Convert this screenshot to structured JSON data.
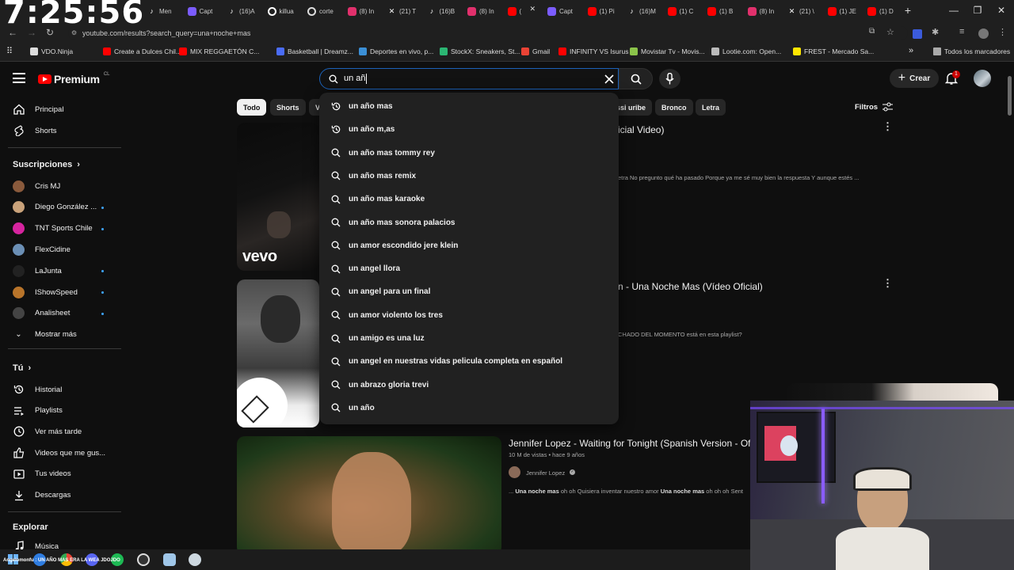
{
  "clock": "7:25:56",
  "tabs": [
    {
      "label": "Men",
      "color": "#ffffff",
      "kind": "tiktok"
    },
    {
      "label": "Capt",
      "color": "#7b5cff",
      "kind": "pen"
    },
    {
      "label": "(16)A",
      "color": "#ffffff",
      "kind": "tiktok"
    },
    {
      "label": "killua",
      "color": "#ffffff",
      "kind": "circle"
    },
    {
      "label": "corte",
      "color": "#dddddd",
      "kind": "google"
    },
    {
      "label": "(8) In",
      "color": "#e1306c",
      "kind": "insta"
    },
    {
      "label": "(21) T",
      "color": "#ffffff",
      "kind": "x"
    },
    {
      "label": "(16)B",
      "color": "#ffffff",
      "kind": "tiktok"
    },
    {
      "label": "(8) In",
      "color": "#e1306c",
      "kind": "insta"
    },
    {
      "label": "(",
      "color": "#ff0000",
      "kind": "yt"
    },
    {
      "label": "Capt",
      "color": "#7b5cff",
      "kind": "pen"
    },
    {
      "label": "(1) Pi",
      "color": "#ff0000",
      "kind": "yt"
    },
    {
      "label": "(16)M",
      "color": "#ffffff",
      "kind": "tiktok"
    },
    {
      "label": "(1) C",
      "color": "#ff0000",
      "kind": "yt"
    },
    {
      "label": "(1) B",
      "color": "#ff0000",
      "kind": "yt"
    },
    {
      "label": "(8) In",
      "color": "#e1306c",
      "kind": "insta"
    },
    {
      "label": "(21) \\",
      "color": "#ffffff",
      "kind": "x"
    },
    {
      "label": "(1) JE",
      "color": "#ff0000",
      "kind": "yt"
    },
    {
      "label": "(1) D",
      "color": "#ff0000",
      "kind": "yt"
    }
  ],
  "address": {
    "url": "youtube.com/results?search_query=una+noche+mas"
  },
  "bookmarks": [
    {
      "label": "VDO.Ninja",
      "color": "#dddddd"
    },
    {
      "label": "Create a Dulces Chil...",
      "color": "#ff0000"
    },
    {
      "label": "MIX REGGAETÓN C...",
      "color": "#ff0000"
    },
    {
      "label": "Basketball | Dreamz...",
      "color": "#4a6cf7"
    },
    {
      "label": "Deportes en vivo, p...",
      "color": "#3b8fd6"
    },
    {
      "label": "StockX: Sneakers, St...",
      "color": "#2bb673"
    },
    {
      "label": "Gmail",
      "color": "#ea4335"
    },
    {
      "label": "INFINITY VS Isurus",
      "color": "#ff0000"
    },
    {
      "label": "Movistar Tv - Movis...",
      "color": "#8bc34a"
    },
    {
      "label": "Lootie.com: Open...",
      "color": "#bbbbbb"
    },
    {
      "label": "FREST - Mercado Sa...",
      "color": "#ffe600"
    }
  ],
  "bookmarks_all": "Todos los marcadores",
  "yt": {
    "logo": "Premium",
    "logo_country": "CL",
    "search_value": "un añ",
    "crear": "Crear",
    "notif_count": "1"
  },
  "sidebar": {
    "main": [
      {
        "label": "Principal",
        "icon": "home-icon"
      },
      {
        "label": "Shorts",
        "icon": "shorts-icon"
      }
    ],
    "subs_title": "Suscripciones",
    "subs": [
      {
        "label": "Cris MJ",
        "color": "#8a5a3c",
        "dot": false
      },
      {
        "label": "Diego González ...",
        "color": "#c9a27a",
        "dot": true
      },
      {
        "label": "TNT Sports Chile",
        "color": "#d6249f",
        "dot": true
      },
      {
        "label": "FlexCidine",
        "color": "#6b8fb5",
        "dot": false
      },
      {
        "label": "LaJunta",
        "color": "#222222",
        "dot": true
      },
      {
        "label": "IShowSpeed",
        "color": "#b8742a",
        "dot": true
      },
      {
        "label": "Analisheet",
        "color": "#444444",
        "dot": true
      }
    ],
    "more": "Mostrar más",
    "you_title": "Tú",
    "you": [
      {
        "label": "Historial",
        "icon": "history-icon"
      },
      {
        "label": "Playlists",
        "icon": "playlist-icon"
      },
      {
        "label": "Ver más tarde",
        "icon": "clock-icon"
      },
      {
        "label": "Videos que me gus...",
        "icon": "like-icon"
      },
      {
        "label": "Tus videos",
        "icon": "video-icon"
      },
      {
        "label": "Descargas",
        "icon": "download-icon"
      }
    ],
    "explore_title": "Explorar",
    "explore": [
      {
        "label": "Música",
        "icon": "music-icon"
      }
    ]
  },
  "chips": [
    "Todo",
    "Shorts",
    "V",
    "ssi uribe",
    "Bronco",
    "Letra"
  ],
  "filters": "Filtros",
  "results": [
    {
      "title": "icial Video)",
      "snippet": "etra No pregunto qué ha pasado Porque ya me sé muy bien la respuesta Y aunque estés ...",
      "badge": "vevo"
    },
    {
      "title": "n - Una Noche Mas (Vídeo Oficial)",
      "snippet": "CHADO DEL MOMENTO está en esta playlist?"
    },
    {
      "title": "Jennifer Lopez - Waiting for Tonight (Spanish Version - Of",
      "meta": "10 M de vistas • hace 9 años",
      "channel": "Jennifer Lopez",
      "snippet_pre": "... ",
      "snippet_b1": "Una noche mas",
      "snippet_mid": " oh oh Quisiera inventar nuestro amor ",
      "snippet_b2": "Una noche mas",
      "snippet_post": " oh oh oh Sent"
    }
  ],
  "suggestions": [
    {
      "label": "un año mas",
      "icon": "history-icon"
    },
    {
      "label": "un año m,as",
      "icon": "history-icon"
    },
    {
      "label": "un año mas tommy rey",
      "icon": "search-icon"
    },
    {
      "label": "un año mas remix",
      "icon": "search-icon"
    },
    {
      "label": "un año mas karaoke",
      "icon": "search-icon"
    },
    {
      "label": "un año mas sonora palacios",
      "icon": "search-icon"
    },
    {
      "label": "un amor escondido jere klein",
      "icon": "search-icon"
    },
    {
      "label": "un angel llora",
      "icon": "search-icon"
    },
    {
      "label": "un angel para un final",
      "icon": "search-icon"
    },
    {
      "label": "un amor violento los tres",
      "icon": "search-icon"
    },
    {
      "label": "un amigo es una luz",
      "icon": "search-icon"
    },
    {
      "label": "un angel en nuestras vidas pelicula completa en español",
      "icon": "search-icon"
    },
    {
      "label": "un abrazo gloria trevi",
      "icon": "search-icon"
    },
    {
      "label": "un año",
      "icon": "search-icon"
    }
  ],
  "taskbar_caption": "Angelomonfu : UN AÑO MAS ERA LA WEA JDOJDO"
}
